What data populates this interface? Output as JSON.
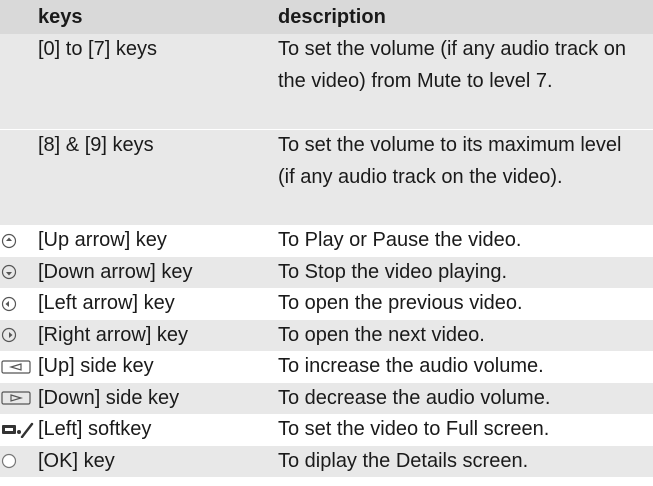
{
  "table": {
    "headers": {
      "keys": "keys",
      "description": "description"
    },
    "rows": [
      {
        "icon": "",
        "key": "[0] to [7] keys",
        "description": "To set the volume (if any audio track on the video) from Mute to level 7."
      },
      {
        "icon": "",
        "key": "[8] & [9] keys",
        "description": "To set the volume to its maximum level (if any audio track on the video)."
      },
      {
        "icon": "nav-up-icon",
        "key": "[Up arrow] key",
        "description": "To Play or Pause the video."
      },
      {
        "icon": "nav-down-icon",
        "key": "[Down arrow] key",
        "description": "To Stop the video playing."
      },
      {
        "icon": "nav-left-icon",
        "key": "[Left arrow] key",
        "description": "To open the previous video."
      },
      {
        "icon": "nav-right-icon",
        "key": "[Right arrow] key",
        "description": "To open the next video."
      },
      {
        "icon": "side-up-key-icon",
        "key": "[Up] side key",
        "description": "To increase the audio volume."
      },
      {
        "icon": "side-down-key-icon",
        "key": "[Down] side key",
        "description": "To decrease the audio volume."
      },
      {
        "icon": "left-softkey-icon",
        "key": "[Left] softkey",
        "description": "To set the video to Full screen."
      },
      {
        "icon": "ok-key-icon",
        "key": "[OK] key",
        "description": "To diplay the Details screen."
      }
    ]
  }
}
